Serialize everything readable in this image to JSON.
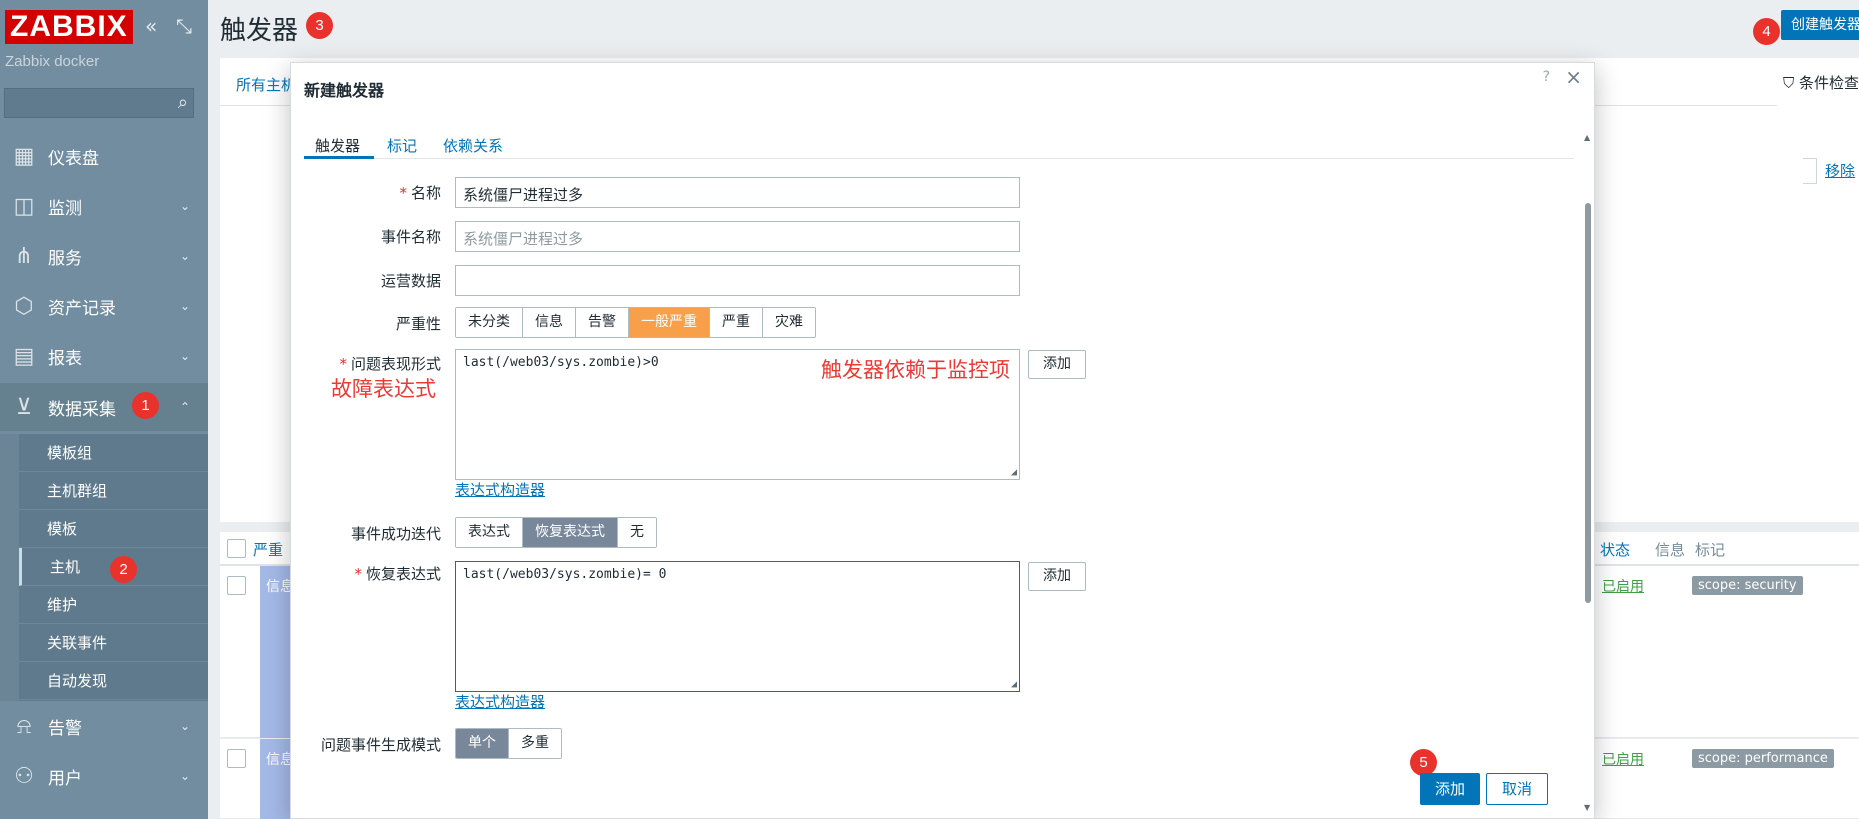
{
  "app": {
    "logo": "ZABBIX",
    "instance_name": "Zabbix docker",
    "page_title": "触发器",
    "create_button": "创建触发器",
    "help_hint": "?"
  },
  "sidebar": {
    "items": [
      {
        "label": "仪表盘",
        "icon": "dashboard-icon"
      },
      {
        "label": "监测",
        "icon": "monitoring-icon"
      },
      {
        "label": "服务",
        "icon": "services-icon"
      },
      {
        "label": "资产记录",
        "icon": "inventory-icon"
      },
      {
        "label": "报表",
        "icon": "reports-icon"
      },
      {
        "label": "数据采集",
        "icon": "data-collection-icon"
      },
      {
        "label": "告警",
        "icon": "bell-icon"
      },
      {
        "label": "用户",
        "icon": "users-icon"
      }
    ],
    "submenu": [
      "模板组",
      "主机群组",
      "模板",
      "主机",
      "维护",
      "关联事件",
      "自动发现"
    ]
  },
  "badges": [
    "1",
    "2",
    "3",
    "4",
    "5"
  ],
  "background": {
    "breadcrumb": "所有主机",
    "filter_tab": "条件检查",
    "remove_link": "移除",
    "columns": {
      "severity": "严重",
      "status": "状态",
      "info": "信息",
      "tags": "标记"
    },
    "rows": [
      {
        "severity": "信息",
        "status": "已启用",
        "tag": "scope: security"
      },
      {
        "severity": "信息",
        "status": "已启用",
        "tag": "scope: performance"
      }
    ]
  },
  "modal": {
    "title": "新建触发器",
    "help": "?",
    "close": "×",
    "tabs": [
      "触发器",
      "标记",
      "依赖关系"
    ],
    "fields": {
      "name_label": "名称",
      "name_value": "系统僵尸进程过多",
      "event_name_label": "事件名称",
      "event_name_placeholder": "系统僵尸进程过多",
      "opdata_label": "运营数据",
      "opdata_value": "",
      "severity_label": "严重性",
      "severity_options": [
        "未分类",
        "信息",
        "告警",
        "一般严重",
        "严重",
        "灾难"
      ],
      "severity_selected": "一般严重",
      "expression_label": "问题表现形式",
      "expression_value": "last(/web03/sys.zombie)>0",
      "add_button": "添加",
      "expr_builder": "表达式构造器",
      "ok_event_label": "事件成功迭代",
      "ok_event_options": [
        "表达式",
        "恢复表达式",
        "无"
      ],
      "ok_event_selected": "恢复表达式",
      "recovery_label": "恢复表达式",
      "recovery_value": "last(/web03/sys.zombie)= 0",
      "recovery_builder": "表达式构造器",
      "gen_mode_label": "问题事件生成模式",
      "gen_mode_options": [
        "单个",
        "多重"
      ],
      "gen_mode_selected": "单个"
    },
    "annotations": {
      "fault_expr": "故障表达式",
      "depends": "触发器依赖于监控项"
    },
    "footer": {
      "add": "添加",
      "cancel": "取消"
    }
  },
  "colors": {
    "sidebar": "#718d9f",
    "accent": "#0275b8",
    "severity_average": "#f89f49",
    "badge": "#e8322b"
  }
}
